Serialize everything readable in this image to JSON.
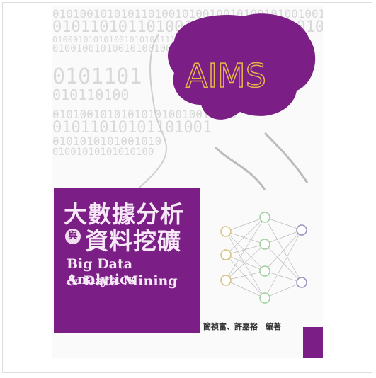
{
  "cover": {
    "title_line1": "大數據分析",
    "connector": "與",
    "title_line2": "資料挖礦",
    "english_line1": "Big Data Analytics",
    "english_line2": "& Data Mining",
    "authors": "簡禎富、許嘉裕　編著",
    "brain_label": "AIMS",
    "accent_color": "#7b1f86"
  }
}
